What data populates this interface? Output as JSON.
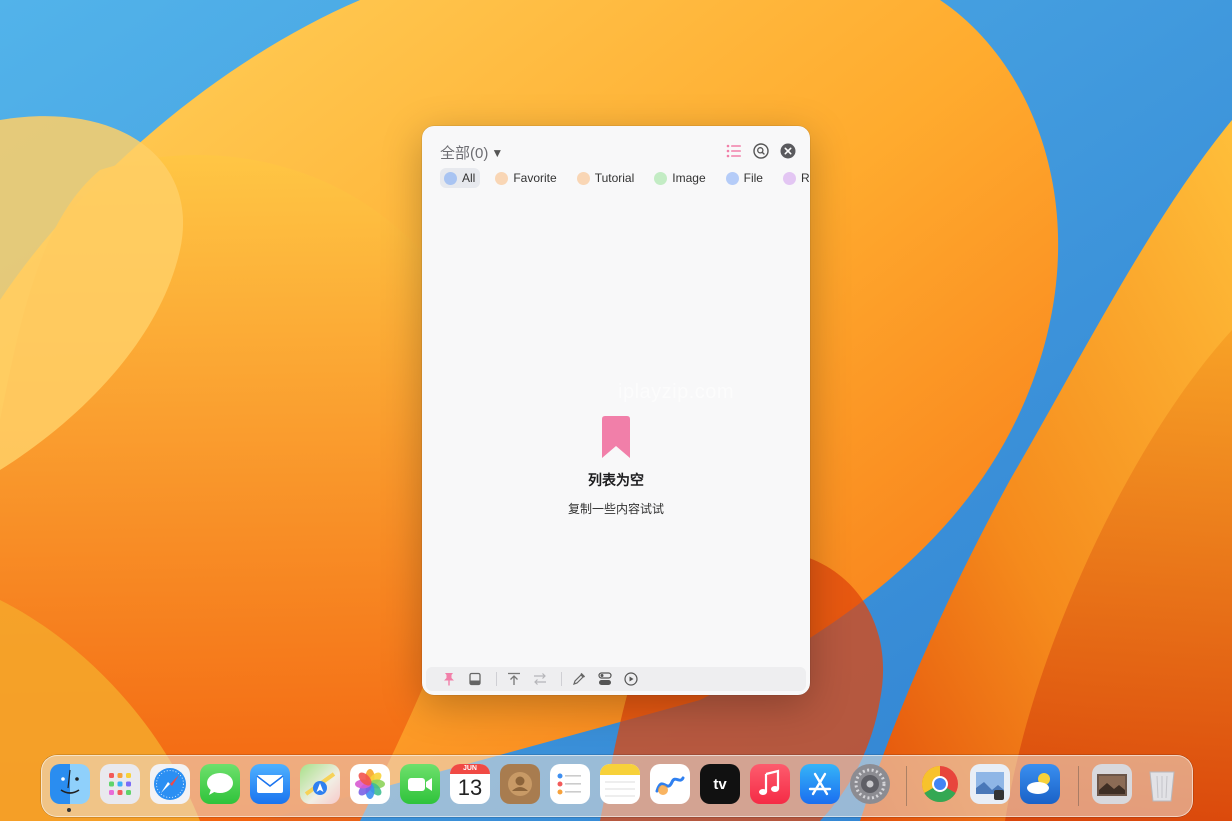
{
  "window": {
    "title": "全部(0)",
    "caret": "▼",
    "tabs": [
      {
        "label": "All",
        "color": "#a9c4f2",
        "active": true
      },
      {
        "label": "Favorite",
        "color": "#f9d6b5",
        "active": false
      },
      {
        "label": "Tutorial",
        "color": "#f9d6b5",
        "active": false
      },
      {
        "label": "Image",
        "color": "#c3ecc4",
        "active": false
      },
      {
        "label": "File",
        "color": "#b5ccf8",
        "active": false
      },
      {
        "label": "Reme",
        "color": "#e3c6f3",
        "active": false
      }
    ],
    "header_icons": [
      "list-icon",
      "search-icon",
      "close-icon"
    ],
    "empty": {
      "icon": "bookmark-icon",
      "title": "列表为空",
      "subtitle": "复制一些内容试试"
    },
    "watermark": "iplayzip.com",
    "bottom_icons": [
      "pin-icon",
      "window-icon",
      "move-to-top-icon",
      "swap-icon",
      "eyedropper-icon",
      "toggle-icon",
      "play-circle-icon"
    ],
    "accent": "#f17fa9"
  },
  "dock": {
    "calendar": {
      "month": "JUN",
      "day": "13"
    },
    "apple_tv_label": "tv",
    "items": [
      "finder-icon",
      "launchpad-icon",
      "safari-icon",
      "messages-icon",
      "mail-icon",
      "maps-icon",
      "photos-icon",
      "facetime-icon",
      "calendar-icon",
      "contacts-icon",
      "reminders-icon",
      "notes-icon",
      "freeform-icon",
      "apple-tv-icon",
      "music-icon",
      "app-store-icon",
      "system-settings-icon",
      "chrome-icon",
      "preview-icon",
      "weather-icon",
      "photo-stack-icon",
      "trash-icon"
    ]
  }
}
